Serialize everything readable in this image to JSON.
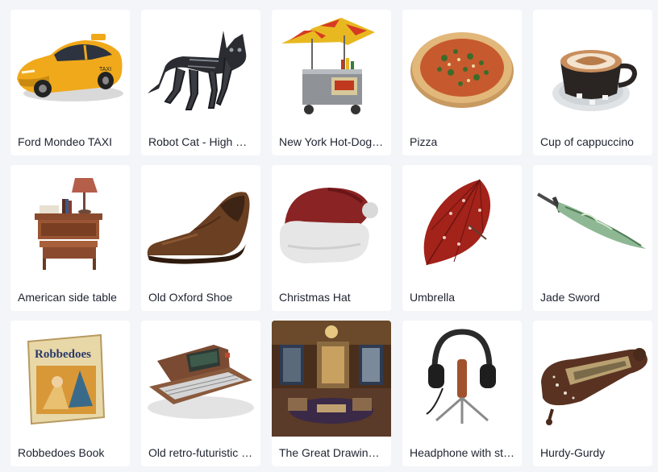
{
  "items": [
    {
      "title": "Ford Mondeo TAXI",
      "icon": "taxi-car-icon"
    },
    {
      "title": "Robot Cat - High Poly",
      "icon": "robot-cat-icon"
    },
    {
      "title": "New York Hot-Dog Stand",
      "icon": "hotdog-stand-icon"
    },
    {
      "title": "Pizza",
      "icon": "pizza-icon"
    },
    {
      "title": "Cup of cappuccino",
      "icon": "cappuccino-icon"
    },
    {
      "title": "American side table",
      "icon": "side-table-icon"
    },
    {
      "title": "Old Oxford Shoe",
      "icon": "oxford-shoe-icon"
    },
    {
      "title": "Christmas Hat",
      "icon": "christmas-hat-icon"
    },
    {
      "title": "Umbrella",
      "icon": "umbrella-icon"
    },
    {
      "title": "Jade Sword",
      "icon": "jade-sword-icon"
    },
    {
      "title": "Robbedoes Book",
      "icon": "comic-book-icon"
    },
    {
      "title": "Old retro-futuristic computer",
      "icon": "retro-computer-icon"
    },
    {
      "title": "The Great Drawing Room",
      "icon": "drawing-room-icon"
    },
    {
      "title": "Headphone with stand",
      "icon": "headphone-stand-icon"
    },
    {
      "title": "Hurdy-Gurdy",
      "icon": "hurdy-gurdy-icon"
    }
  ],
  "book_cover_text": "Robbedoes"
}
